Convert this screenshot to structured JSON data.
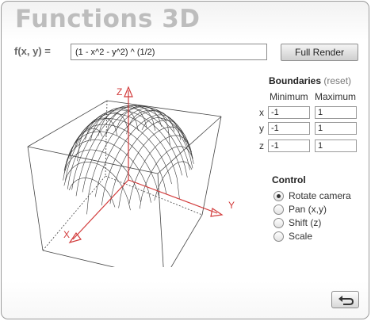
{
  "app": {
    "title": "Functions 3D"
  },
  "function": {
    "label": "f(x, y)  =",
    "expression": "(1 - x^2 - y^2) ^ (1/2)"
  },
  "buttons": {
    "full_render": "Full Render",
    "undo_icon": "return-arrow-icon"
  },
  "plot_axes": {
    "x": "X",
    "y": "Y",
    "z": "Z"
  },
  "colors": {
    "axis": "#d23b3b",
    "mesh": "#3a3a3a",
    "box": "#444444"
  },
  "boundaries": {
    "title": "Boundaries",
    "reset": "(reset)",
    "min_header": "Minimum",
    "max_header": "Maximum",
    "rows": [
      {
        "axis": "x",
        "min": "-1",
        "max": "1"
      },
      {
        "axis": "y",
        "min": "-1",
        "max": "1"
      },
      {
        "axis": "z",
        "min": "-1",
        "max": "1"
      }
    ]
  },
  "control": {
    "title": "Control",
    "options": [
      {
        "label": "Rotate camera",
        "selected": true
      },
      {
        "label": "Pan (x,y)",
        "selected": false
      },
      {
        "label": "Shift (z)",
        "selected": false
      },
      {
        "label": "Scale",
        "selected": false
      }
    ]
  }
}
